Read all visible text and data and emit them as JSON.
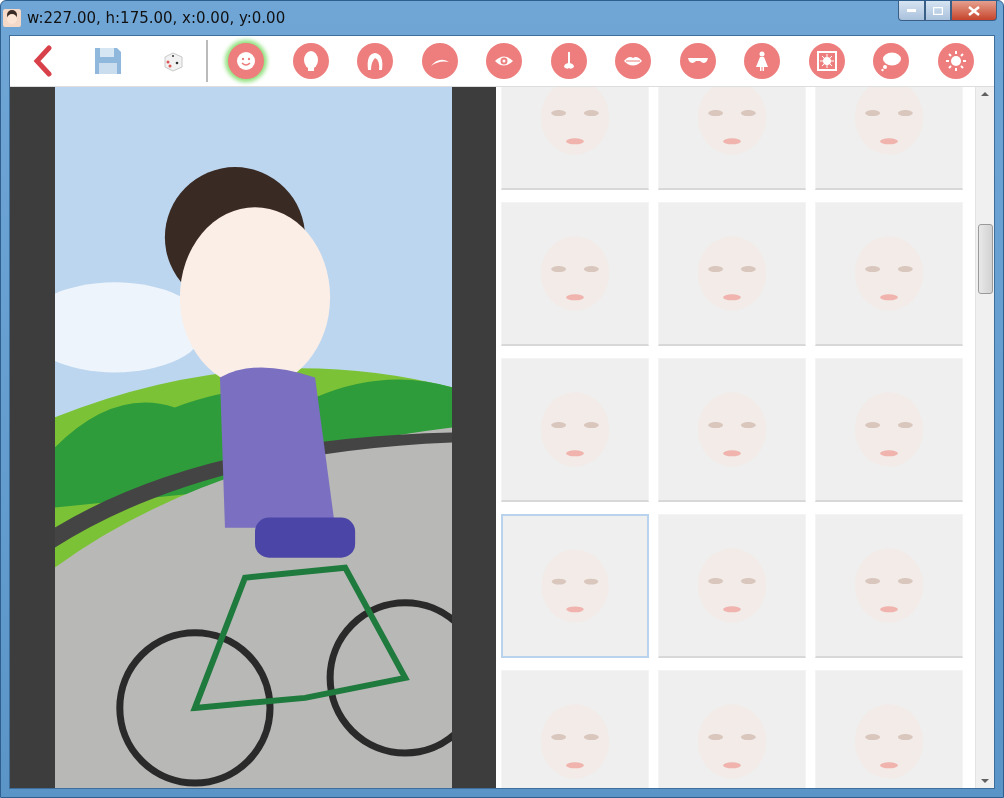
{
  "window": {
    "title": "w:227.00, h:175.00, x:0.00, y:0.00"
  },
  "actions": [
    {
      "kind": "back"
    },
    {
      "kind": "save"
    },
    {
      "kind": "dice"
    }
  ],
  "categories": [
    {
      "kind": "smiley",
      "selected": true
    },
    {
      "kind": "head",
      "selected": false
    },
    {
      "kind": "hair",
      "selected": false
    },
    {
      "kind": "eyebrow",
      "selected": false
    },
    {
      "kind": "eye",
      "selected": false
    },
    {
      "kind": "nose",
      "selected": false
    },
    {
      "kind": "lips",
      "selected": false
    },
    {
      "kind": "glasses",
      "selected": false
    },
    {
      "kind": "dress",
      "selected": false
    },
    {
      "kind": "frame",
      "selected": false
    },
    {
      "kind": "bubble",
      "selected": false
    },
    {
      "kind": "sun",
      "selected": false
    }
  ],
  "tiles": [
    {
      "selected": false
    },
    {
      "selected": false
    },
    {
      "selected": false
    },
    {
      "selected": false
    },
    {
      "selected": false
    },
    {
      "selected": false
    },
    {
      "selected": false
    },
    {
      "selected": false
    },
    {
      "selected": false
    },
    {
      "selected": true
    },
    {
      "selected": false
    },
    {
      "selected": false
    },
    {
      "selected": false
    },
    {
      "selected": false
    },
    {
      "selected": false
    }
  ]
}
